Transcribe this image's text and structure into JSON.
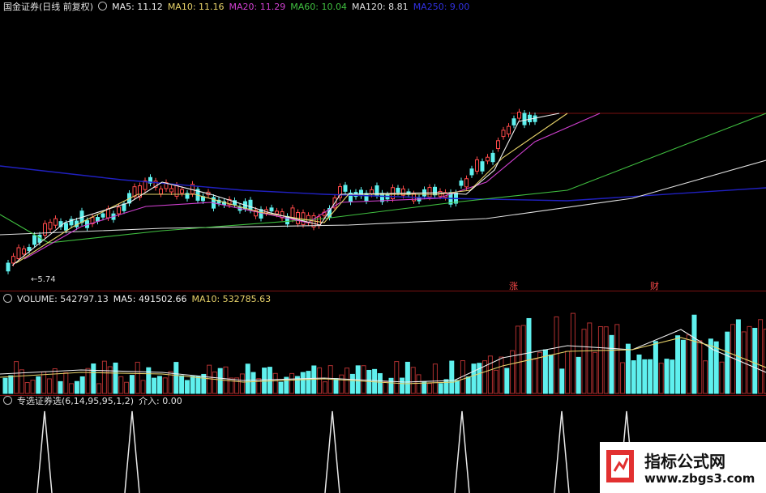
{
  "main_legend": {
    "stock": "国金证券(日线 前复权)",
    "ma5": "MA5: 11.12",
    "ma10": "MA10: 11.16",
    "ma20": "MA20: 11.29",
    "ma60": "MA60: 10.04",
    "ma120": "MA120: 8.81",
    "ma250": "MA250: 9.00"
  },
  "low_price_label": "5.74",
  "markers": {
    "rise": "涨",
    "finance": "财"
  },
  "volume_legend": {
    "volume": "VOLUME: 542797.13",
    "ma5": "MA5: 491502.66",
    "ma10": "MA10: 532785.63"
  },
  "indicator_legend": {
    "name": "专选证券选(6,14,95,95,1,2)",
    "value": "介入: 0.00"
  },
  "watermark": {
    "title": "指标公式网",
    "url": "www.zbgs3.com"
  },
  "colors": {
    "up": "#ff4a4a",
    "down": "#5ff0ee",
    "ma5": "#f0f0f0",
    "ma10": "#e8d36a",
    "ma20": "#d040d0",
    "ma60": "#40c040",
    "ma120": "#e0e0e0",
    "ma250": "#2020c0"
  }
}
